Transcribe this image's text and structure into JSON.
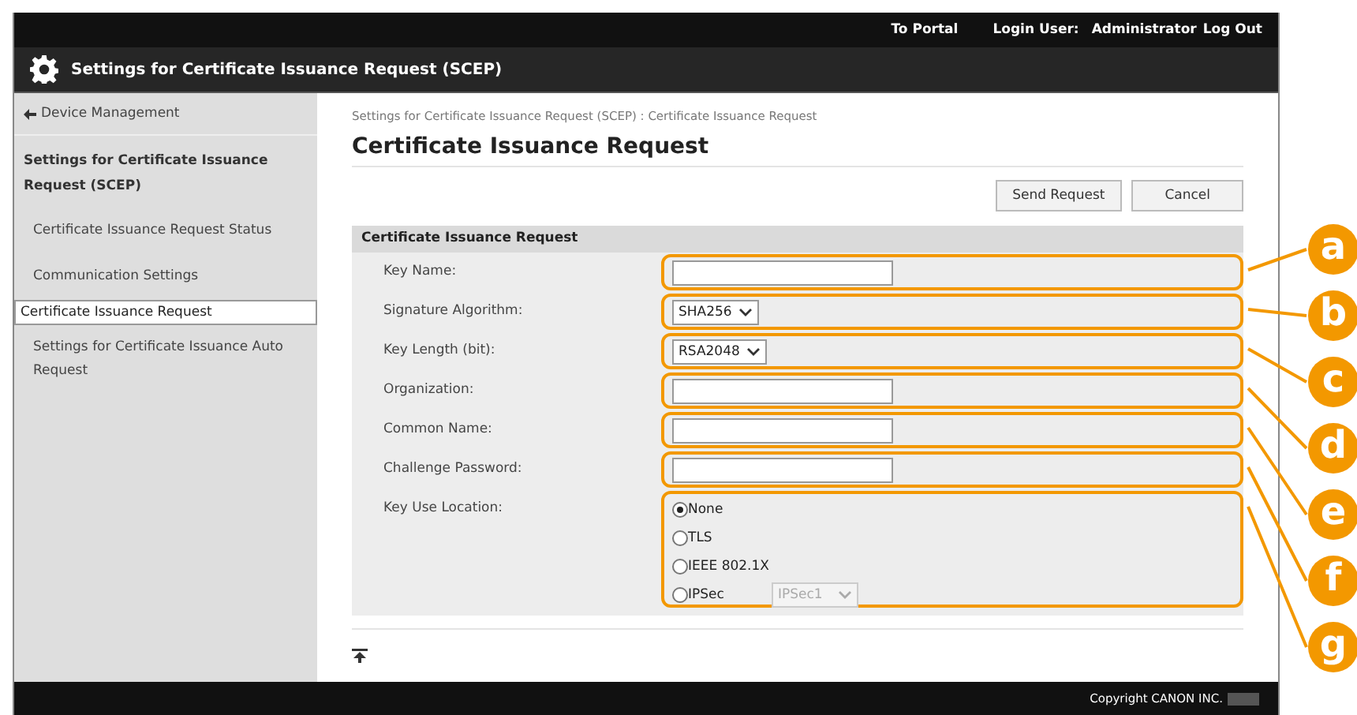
{
  "top_bar": {
    "portal_link": "To Portal",
    "login_label": "Login User:",
    "user": "Administrator",
    "logout_link": "Log Out"
  },
  "title_bar": {
    "title": "Settings for Certificate Issuance Request (SCEP)"
  },
  "sidebar": {
    "back_link": "Device Management",
    "section": "Settings for Certificate Issuance Request (SCEP)",
    "items": [
      {
        "label": "Certificate Issuance Request Status",
        "selected": false
      },
      {
        "label": "Communication Settings",
        "selected": false
      },
      {
        "label": "Certificate Issuance Request",
        "selected": true
      },
      {
        "label": "Settings for Certificate Issuance Auto Request",
        "selected": false
      }
    ]
  },
  "breadcrumb": "Settings for Certificate Issuance Request (SCEP) : Certificate Issuance Request",
  "heading": "Certificate Issuance Request",
  "buttons": [
    "Send Request",
    "Cancel"
  ],
  "form": {
    "title": "Certificate Issuance Request",
    "rows": [
      {
        "label": "Key Name:",
        "kind": "text",
        "callout": "a"
      },
      {
        "label": "Signature Algorithm:",
        "kind": "select",
        "value": "SHA256",
        "callout": "b"
      },
      {
        "label": "Key Length (bit):",
        "kind": "select",
        "value": "RSA2048",
        "callout": "c"
      },
      {
        "label": "Organization:",
        "kind": "text",
        "callout": "d"
      },
      {
        "label": "Common Name:",
        "kind": "text",
        "callout": "e"
      },
      {
        "label": "Challenge Password:",
        "kind": "text",
        "callout": "f"
      },
      {
        "label": "Key Use Location:",
        "kind": "radios",
        "callout": "g",
        "options": [
          {
            "label": "None",
            "selected": true
          },
          {
            "label": "TLS",
            "selected": false
          },
          {
            "label": "IEEE 802.1X",
            "selected": false
          },
          {
            "label": "IPSec",
            "selected": false,
            "select": {
              "value": "IPSec1",
              "disabled": true
            }
          }
        ]
      }
    ]
  },
  "footer": {
    "copyright": "Copyright CANON INC."
  }
}
